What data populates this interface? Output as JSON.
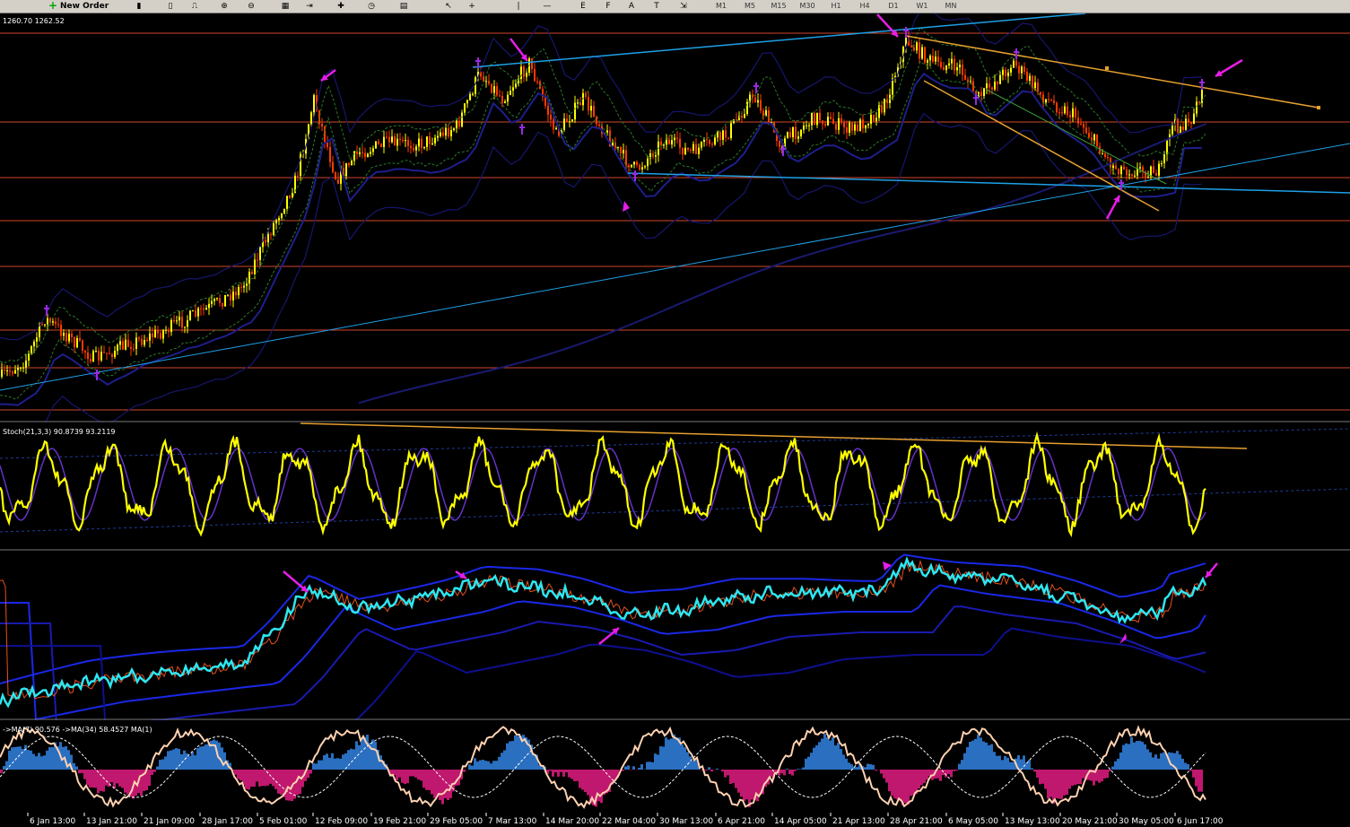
{
  "toolbar": {
    "new_order_label": "New Order",
    "timeframes": [
      "M1",
      "M5",
      "M15",
      "M30",
      "H1",
      "H4",
      "D1",
      "W1",
      "MN"
    ]
  },
  "main_panel": {
    "price_label": "1260.70 1262.52"
  },
  "stoch_panel": {
    "label": "Stoch(21,3,3) 90.8739 93.2119"
  },
  "bottom_panel": {
    "label": "->MA(7) 90.576  ->MA(34) 58.4527  MA(1)"
  },
  "x_axis": {
    "labels": [
      "6 Jan 13:00",
      "13 Jan 21:00",
      "21 Jan 09:00",
      "28 Jan 17:00",
      "5 Feb 01:00",
      "12 Feb 09:00",
      "19 Feb 21:00",
      "29 Feb 05:00",
      "7 Mar 13:00",
      "14 Mar 20:00",
      "22 Mar 04:00",
      "30 Mar 13:00",
      "6 Apr 21:00",
      "14 Apr 05:00",
      "21 Apr 13:00",
      "28 Apr 21:00",
      "6 May 05:00",
      "13 May 13:00",
      "20 May 21:00",
      "30 May 05:00",
      "6 Jun 17:00"
    ]
  },
  "colors": {
    "background": "#000000",
    "hline": "#d2462d",
    "trend_blue": "#1ea0e6",
    "trend_orange": "#e6a030",
    "bull_candle": "#ffff00",
    "bear_candle": "#ff3c00",
    "stoch_main": "#ffff00",
    "stoch_signal": "#6432c8",
    "cyan_line": "#2ee6f0",
    "band_blue": "#1a28e6",
    "hist_pos": "#2a6fc0",
    "hist_neg": "#c0186e",
    "arrow_magenta": "#e61ee6",
    "fractal_purple": "#9a28e6"
  }
}
